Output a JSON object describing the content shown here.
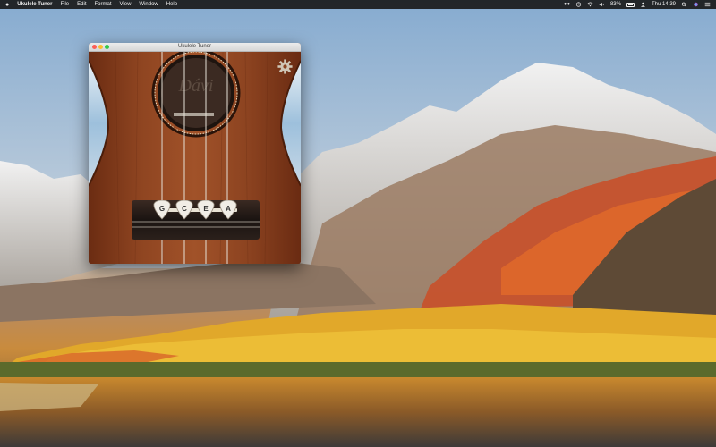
{
  "menubar": {
    "apple_icon": "apple-icon",
    "app_name": "Ukulele Tuner",
    "menus": [
      "File",
      "Edit",
      "Format",
      "View",
      "Window",
      "Help"
    ],
    "battery_percent": "83%",
    "clock": "Thu 14:39"
  },
  "window": {
    "title": "Ukulele Tuner",
    "settings_icon": "gear-icon",
    "strings": [
      "G",
      "C",
      "E",
      "A"
    ]
  },
  "colors": {
    "menubar_bg": "#1a1a1a",
    "wood": "#8b4322",
    "accent_close": "#fc5f57",
    "accent_min": "#fdbc2e",
    "accent_max": "#33c748"
  }
}
